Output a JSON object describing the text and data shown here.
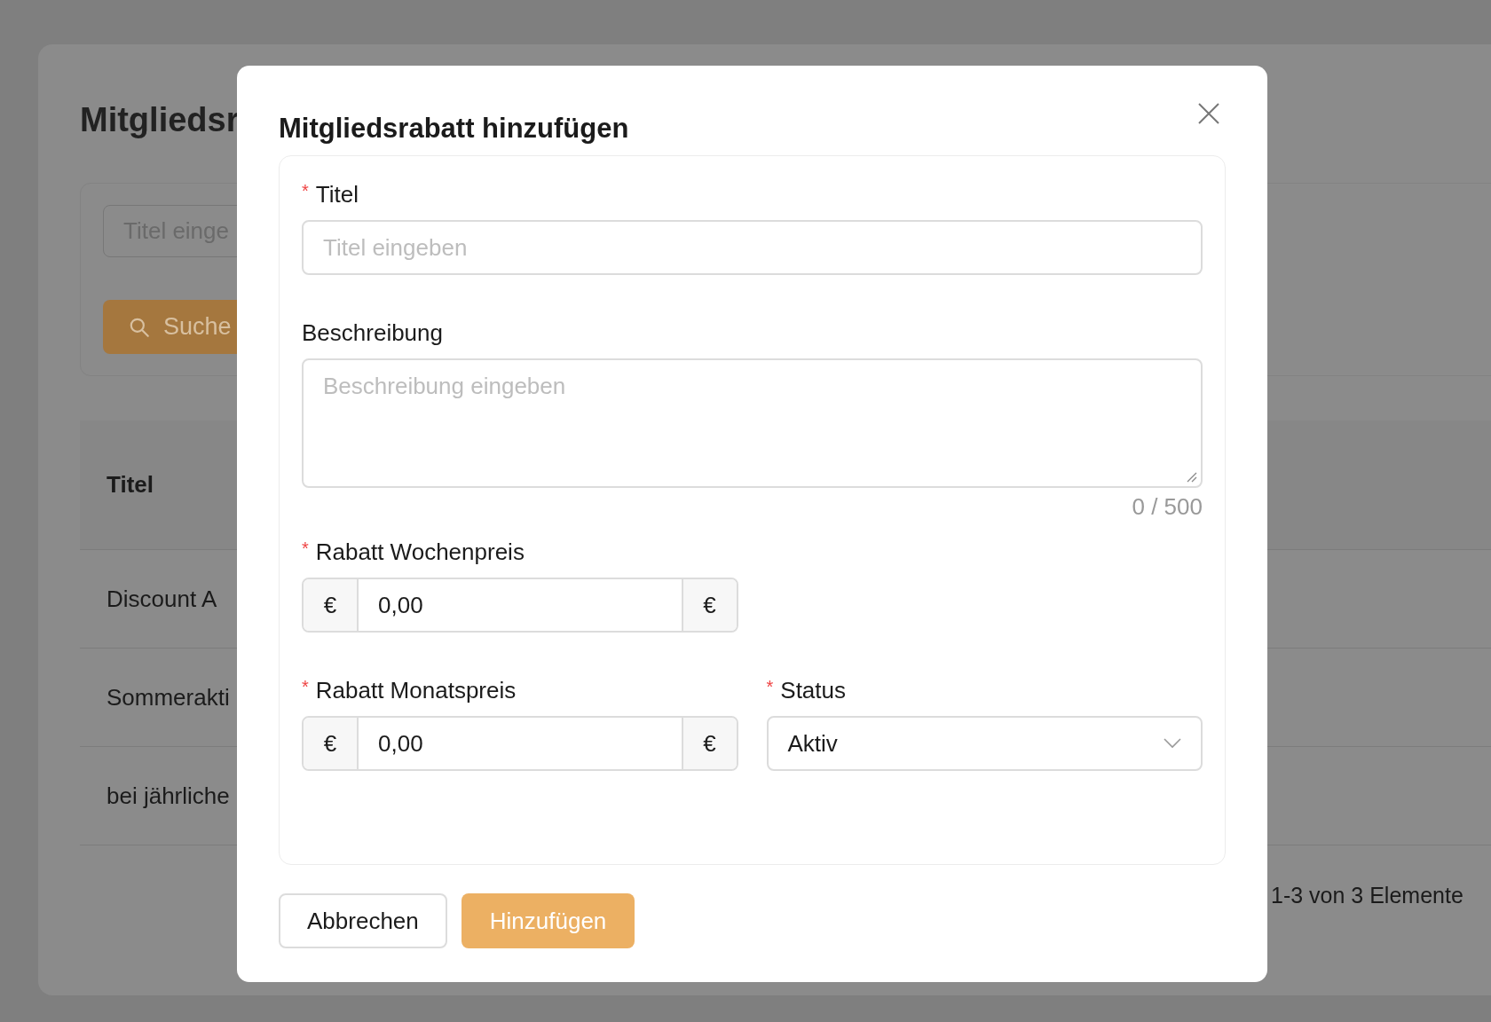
{
  "background": {
    "title": "Mitgliedsr",
    "search": {
      "placeholder": "Titel einge"
    },
    "search_button": "Suche",
    "table": {
      "columns": [
        "Titel"
      ],
      "rows": [
        "Discount A",
        "Sommerakti",
        "bei jährliche"
      ]
    },
    "pagination": "1-3 von 3 Elemente"
  },
  "dialog": {
    "title": "Mitgliedsrabatt hinzufügen",
    "rows": [
      {
        "fields": [
          {
            "kind": "text",
            "label": "Titel",
            "required_mark": "*",
            "placeholder": "Titel eingeben"
          }
        ]
      },
      {
        "fields": [
          {
            "kind": "textarea",
            "label": "Beschreibung",
            "placeholder": "Beschreibung eingeben",
            "counter": "0 / 500"
          }
        ]
      },
      {
        "fields": [
          {
            "kind": "money",
            "label": "Rabatt Wochenpreis",
            "required_mark": "*",
            "prefix": "€",
            "value": "0,00",
            "suffix": "€"
          }
        ]
      },
      {
        "fields": [
          {
            "kind": "money",
            "label": "Rabatt Monatspreis",
            "required_mark": "*",
            "prefix": "€",
            "value": "0,00",
            "suffix": "€"
          },
          {
            "kind": "select",
            "label": "Status",
            "required_mark": "*",
            "value": "Aktiv"
          }
        ]
      }
    ],
    "buttons": [
      {
        "label": "Abbrechen",
        "kind": "default"
      },
      {
        "label": "Hinzufügen",
        "kind": "primary"
      }
    ]
  }
}
